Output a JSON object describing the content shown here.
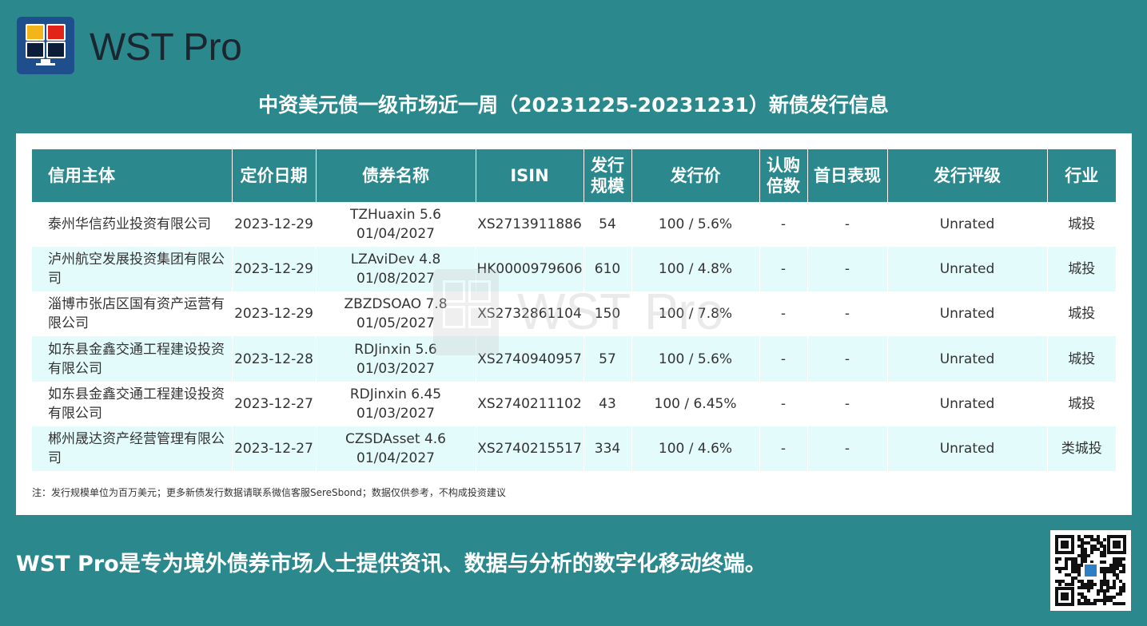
{
  "brand": {
    "name": "WST Pro"
  },
  "page": {
    "title": "中资美元债一级市场近一周（20231225-20231231）新债发行信息"
  },
  "table": {
    "headers": [
      "信用主体",
      "定价日期",
      "债券名称",
      "ISIN",
      "发行规模",
      "发行价",
      "认购倍数",
      "首日表现",
      "发行评级",
      "行业"
    ],
    "rows": [
      {
        "issuer": "泰州华信药业投资有限公司",
        "date": "2023-12-29",
        "bond": "TZHuaxin 5.6 01/04/2027",
        "isin": "XS2713911886",
        "size": "54",
        "price": "100 / 5.6%",
        "sub": "-",
        "first_day": "-",
        "rating": "Unrated",
        "industry": "城投"
      },
      {
        "issuer": "泸州航空发展投资集团有限公司",
        "date": "2023-12-29",
        "bond": "LZAviDev 4.8 01/08/2027",
        "isin": "HK0000979606",
        "size": "610",
        "price": "100 / 4.8%",
        "sub": "-",
        "first_day": "-",
        "rating": "Unrated",
        "industry": "城投"
      },
      {
        "issuer": "淄博市张店区国有资产运营有限公司",
        "date": "2023-12-29",
        "bond": "ZBZDSOAO 7.8 01/05/2027",
        "isin": "XS2732861104",
        "size": "150",
        "price": "100 / 7.8%",
        "sub": "-",
        "first_day": "-",
        "rating": "Unrated",
        "industry": "城投"
      },
      {
        "issuer": "如东县金鑫交通工程建设投资有限公司",
        "date": "2023-12-28",
        "bond": "RDJinxin 5.6 01/03/2027",
        "isin": "XS2740940957",
        "size": "57",
        "price": "100 / 5.6%",
        "sub": "-",
        "first_day": "-",
        "rating": "Unrated",
        "industry": "城投"
      },
      {
        "issuer": "如东县金鑫交通工程建设投资有限公司",
        "date": "2023-12-27",
        "bond": "RDJinxin 6.45 01/03/2027",
        "isin": "XS2740211102",
        "size": "43",
        "price": "100 / 6.45%",
        "sub": "-",
        "first_day": "-",
        "rating": "Unrated",
        "industry": "城投"
      },
      {
        "issuer": "郴州晟达资产经营管理有限公司",
        "date": "2023-12-27",
        "bond": "CZSDAsset 4.6 01/04/2027",
        "isin": "XS2740215517",
        "size": "334",
        "price": "100 / 4.6%",
        "sub": "-",
        "first_day": "-",
        "rating": "Unrated",
        "industry": "类城投"
      }
    ]
  },
  "watermark": {
    "text": "WST Pro"
  },
  "footnote": "注：发行规模单位为百万美元；更多新债发行数据请联系微信客服SereSbond；数据仅供参考，不构成投资建议",
  "tagline": "WST Pro是专为境外债券市场人士提供资讯、数据与分析的数字化移动终端。",
  "colors": {
    "background": "#2b898e",
    "logo_blue": "#1f4e8c",
    "row_alt": "#e4fbfc",
    "yellow": "#f2b51b",
    "red": "#e2231a",
    "navy": "#0c1d3a"
  },
  "icons": {
    "logo": "monitor-logo-icon",
    "qr": "qr-code-icon"
  }
}
